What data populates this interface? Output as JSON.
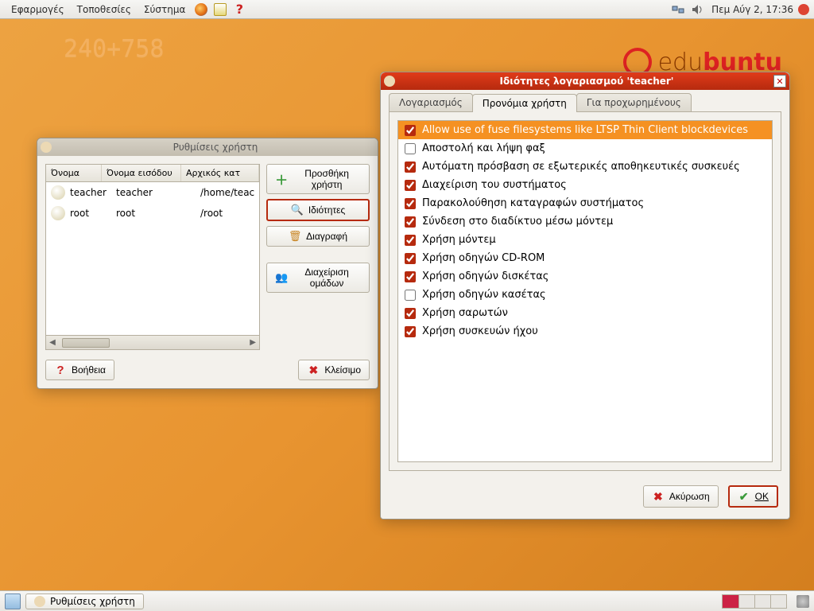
{
  "panel": {
    "menus": [
      "Εφαρμογές",
      "Τοποθεσίες",
      "Σύστημα"
    ],
    "clock": "Πεμ Αύγ  2, 17:36"
  },
  "desktop": {
    "scribble1": "240+758",
    "logo_edu": "edu",
    "logo_buntu": "buntu"
  },
  "users_window": {
    "title": "Ρυθμίσεις χρήστη",
    "columns": {
      "name": "Όνομα",
      "login": "Όνομα εισόδου",
      "home": "Αρχικός κατ"
    },
    "rows": [
      {
        "name": "teacher",
        "login": "teacher",
        "home": "/home/teac"
      },
      {
        "name": "root",
        "login": "root",
        "home": "/root"
      }
    ],
    "buttons": {
      "add": "Προσθήκη χρήστη",
      "props": "Ιδιότητες",
      "delete": "Διαγραφή",
      "groups": "Διαχείριση ομάδων"
    },
    "help": "Βοήθεια",
    "close": "Κλείσιμο"
  },
  "props_window": {
    "title": "Ιδιότητες λογαριασμού 'teacher'",
    "tabs": {
      "account": "Λογαριασμός",
      "privs": "Προνόμια χρήστη",
      "advanced": "Για προχωρημένους"
    },
    "privileges": [
      {
        "checked": true,
        "selected": true,
        "label": "Allow use of fuse filesystems like LTSP Thin Client blockdevices"
      },
      {
        "checked": false,
        "selected": false,
        "label": "Αποστολή και λήψη φαξ"
      },
      {
        "checked": true,
        "selected": false,
        "label": "Αυτόματη πρόσβαση σε εξωτερικές αποθηκευτικές συσκευές"
      },
      {
        "checked": true,
        "selected": false,
        "label": "Διαχείριση του συστήματος"
      },
      {
        "checked": true,
        "selected": false,
        "label": "Παρακολούθηση καταγραφών συστήματος"
      },
      {
        "checked": true,
        "selected": false,
        "label": "Σύνδεση στο διαδίκτυο μέσω μόντεμ"
      },
      {
        "checked": true,
        "selected": false,
        "label": "Χρήση μόντεμ"
      },
      {
        "checked": true,
        "selected": false,
        "label": "Χρήση οδηγών CD-ROM"
      },
      {
        "checked": true,
        "selected": false,
        "label": "Χρήση οδηγών δισκέτας"
      },
      {
        "checked": false,
        "selected": false,
        "label": "Χρήση οδηγών κασέτας"
      },
      {
        "checked": true,
        "selected": false,
        "label": "Χρήση σαρωτών"
      },
      {
        "checked": true,
        "selected": false,
        "label": "Χρήση συσκευών ήχου"
      }
    ],
    "cancel": "Ακύρωση",
    "ok": "OK"
  },
  "taskbar": {
    "button": "Ρυθμίσεις χρήστη"
  }
}
